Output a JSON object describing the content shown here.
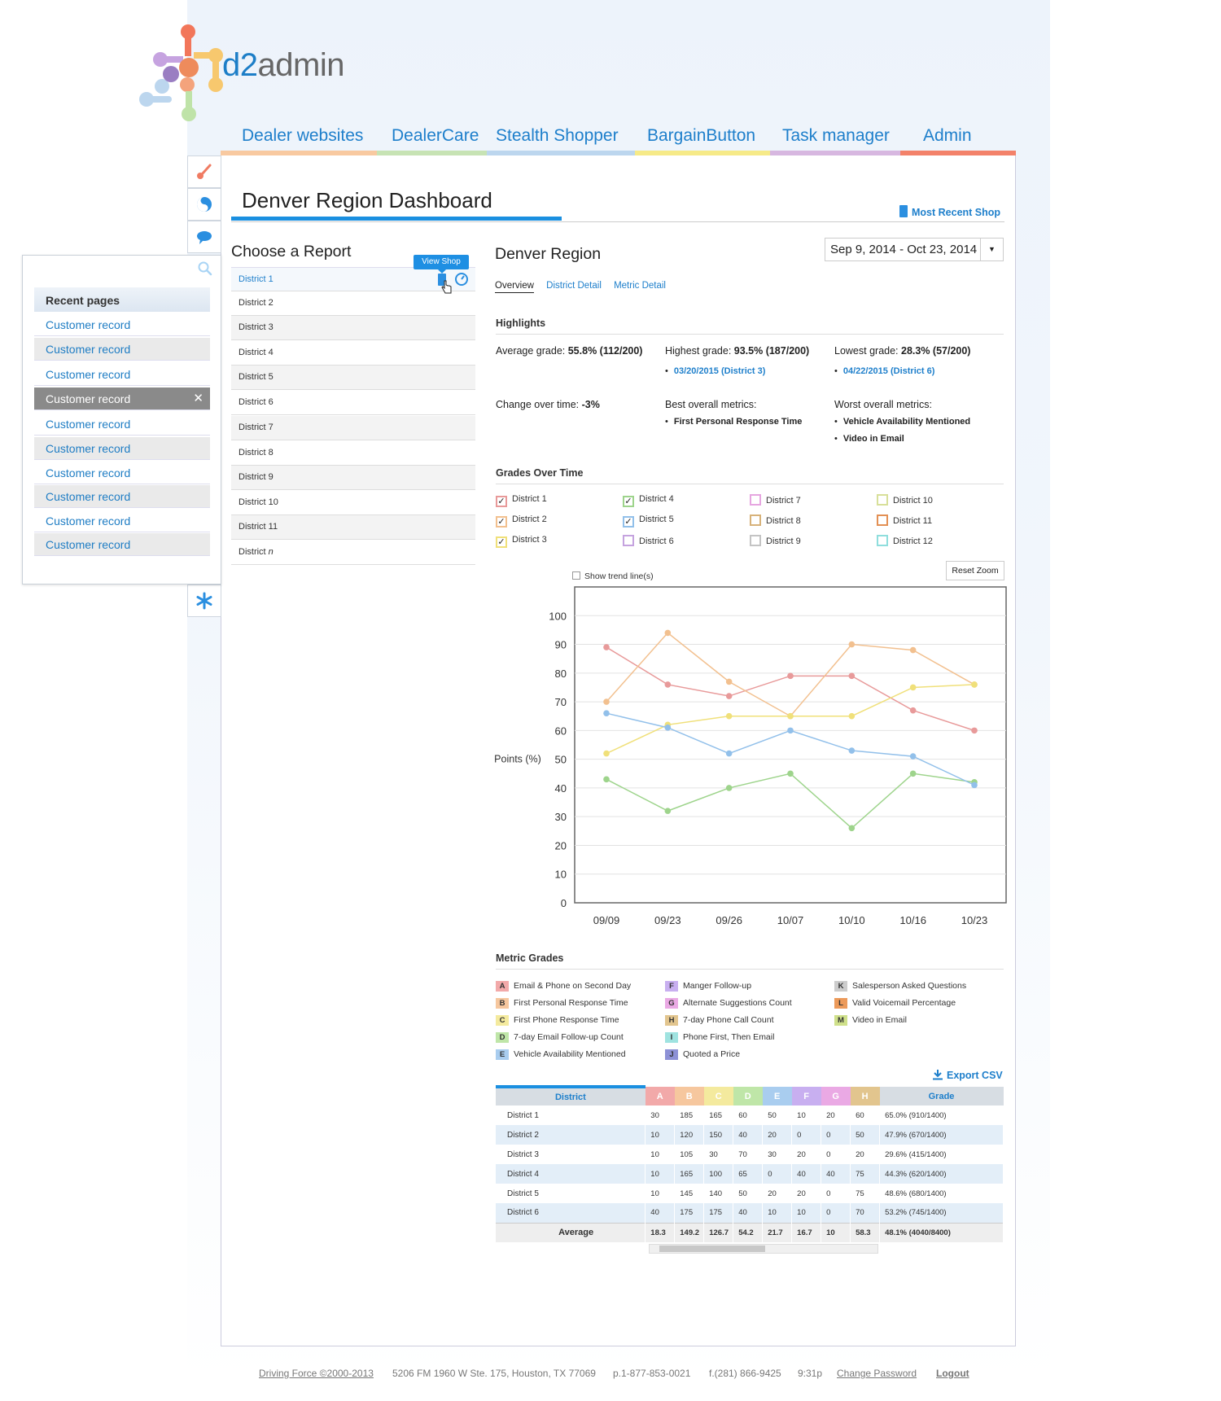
{
  "app": {
    "logo_text": "d2admin",
    "logo_prefix": "d2",
    "logo_suffix": "admin"
  },
  "nav": [
    {
      "label": "Dealer websites",
      "color": "#f8c9a0"
    },
    {
      "label": "DealerCare",
      "color": "#c7e3b4"
    },
    {
      "label": "Stealth Shopper",
      "color": "#bcd6ee"
    },
    {
      "label": "BargainButton",
      "color": "#f6ea88"
    },
    {
      "label": "Task manager",
      "color": "#d7b7e0"
    },
    {
      "label": "Admin",
      "color": "#f3826a"
    }
  ],
  "sidebar_icons": [
    "brush-icon",
    "yin-yang-icon",
    "speech-bubble-icon",
    "search-icon",
    "asterisk-icon"
  ],
  "recent": {
    "heading": "Recent pages",
    "items": [
      "Customer record",
      "Customer record",
      "Customer record",
      "Customer record",
      "Customer record",
      "Customer record",
      "Customer record",
      "Customer record",
      "Customer record",
      "Customer record"
    ]
  },
  "page": {
    "title": "Denver Region Dashboard",
    "most_recent_shop": "Most Recent Shop"
  },
  "report": {
    "heading": "Choose a Report",
    "tooltip": "View Shop",
    "districts": [
      "District 1",
      "District 2",
      "District 3",
      "District 4",
      "District 5",
      "District 6",
      "District 7",
      "District 8",
      "District 9",
      "District 10",
      "District 11",
      "District "
    ],
    "last_italic": "n"
  },
  "region": {
    "title": "Denver Region",
    "date_range": "Sep 9, 2014 - Oct 23, 2014",
    "tabs": [
      "Overview",
      "District Detail",
      "Metric Detail"
    ]
  },
  "highlights": {
    "heading": "Highlights",
    "avg_label": "Average grade: ",
    "avg_value": "55.8% (112/200)",
    "high_label": "Highest grade: ",
    "high_value": "93.5% (187/200)",
    "high_link": "03/20/2015 (District 3)",
    "low_label": "Lowest grade: ",
    "low_value": "28.3% (57/200)",
    "low_link": "04/22/2015 (District 6)",
    "change_label": "Change over time: ",
    "change_value": "-3%",
    "best_label": "Best overall metrics:",
    "best": [
      "First Personal Response Time"
    ],
    "worst_label": "Worst overall metrics:",
    "worst": [
      "Vehicle Availability Mentioned",
      "Video in Email"
    ]
  },
  "grades_over_time": {
    "heading": "Grades Over Time",
    "legend": [
      {
        "label": "District 1",
        "color": "#e89a9a",
        "checked": true
      },
      {
        "label": "District 2",
        "color": "#f2c08f",
        "checked": true
      },
      {
        "label": "District 3",
        "color": "#f0e07a",
        "checked": true
      },
      {
        "label": "District 4",
        "color": "#9ed48c",
        "checked": true
      },
      {
        "label": "District 5",
        "color": "#92c0ea",
        "checked": true
      },
      {
        "label": "District 6",
        "color": "#c5a3df",
        "checked": false
      },
      {
        "label": "District 7",
        "color": "#e6a6e0",
        "checked": false
      },
      {
        "label": "District 8",
        "color": "#d7b27a",
        "checked": false
      },
      {
        "label": "District 9",
        "color": "#c4c4c4",
        "checked": false
      },
      {
        "label": "District 10",
        "color": "#d8e09a",
        "checked": false
      },
      {
        "label": "District 11",
        "color": "#e39054",
        "checked": false
      },
      {
        "label": "District 12",
        "color": "#8fdedd",
        "checked": false
      }
    ],
    "show_trend": "Show trend line(s)",
    "reset_zoom": "Reset Zoom"
  },
  "chart_data": {
    "type": "line",
    "ylabel": "Points (%)",
    "xlabel": "",
    "ylim": [
      0,
      100
    ],
    "yticks": [
      0,
      10,
      20,
      30,
      40,
      50,
      60,
      70,
      80,
      90,
      100
    ],
    "categories": [
      "09/09",
      "09/23",
      "09/26",
      "10/07",
      "10/10",
      "10/16",
      "10/23"
    ],
    "grid": true,
    "series": [
      {
        "name": "District 1",
        "color": "#e89a9a",
        "values": [
          89,
          76,
          72,
          79,
          79,
          67,
          60
        ]
      },
      {
        "name": "District 2",
        "color": "#f2c08f",
        "values": [
          70,
          94,
          77,
          65,
          90,
          88,
          76
        ]
      },
      {
        "name": "District 3",
        "color": "#f0e07a",
        "values": [
          52,
          62,
          65,
          65,
          65,
          75,
          76
        ]
      },
      {
        "name": "District 4",
        "color": "#9ed48c",
        "values": [
          43,
          32,
          40,
          45,
          26,
          45,
          42
        ]
      },
      {
        "name": "District 5",
        "color": "#92c0ea",
        "values": [
          66,
          61,
          52,
          60,
          53,
          51,
          41
        ]
      }
    ]
  },
  "metric_grades": {
    "heading": "Metric Grades",
    "items": [
      {
        "key": "A",
        "label": "Email & Phone on Second Day",
        "color": "#f2a9a9"
      },
      {
        "key": "B",
        "label": "First Personal Response Time",
        "color": "#f6c79e"
      },
      {
        "key": "C",
        "label": "First Phone Response Time",
        "color": "#f4ea9e"
      },
      {
        "key": "D",
        "label": "7-day Email Follow-up Count",
        "color": "#bfe6a8"
      },
      {
        "key": "E",
        "label": "Vehicle Availability Mentioned",
        "color": "#a9cdef"
      },
      {
        "key": "F",
        "label": "Manger Follow-up",
        "color": "#c8aff0"
      },
      {
        "key": "G",
        "label": "Alternate Suggestions Count",
        "color": "#eaa9e4"
      },
      {
        "key": "H",
        "label": "7-day Phone Call Count",
        "color": "#e2c58e"
      },
      {
        "key": "I",
        "label": "Phone First, Then Email",
        "color": "#9fe3e0"
      },
      {
        "key": "J",
        "label": "Quoted a Price",
        "color": "#8d91d6"
      },
      {
        "key": "K",
        "label": "Salesperson Asked Questions",
        "color": "#cccccc"
      },
      {
        "key": "L",
        "label": "Valid Voicemail Percentage",
        "color": "#ec9a5a"
      },
      {
        "key": "M",
        "label": "Video in Email",
        "color": "#cfe08a"
      }
    ],
    "export": "Export CSV"
  },
  "table": {
    "headers": [
      "District",
      "A",
      "B",
      "C",
      "D",
      "E",
      "F",
      "G",
      "H",
      "Grade"
    ],
    "rows": [
      [
        "District 1",
        "30",
        "185",
        "165",
        "60",
        "50",
        "10",
        "20",
        "60",
        "65.0% (910/1400)"
      ],
      [
        "District 2",
        "10",
        "120",
        "150",
        "40",
        "20",
        "0",
        "0",
        "50",
        "47.9% (670/1400)"
      ],
      [
        "District 3",
        "10",
        "105",
        "30",
        "70",
        "30",
        "20",
        "0",
        "20",
        "29.6% (415/1400)"
      ],
      [
        "District 4",
        "10",
        "165",
        "100",
        "65",
        "0",
        "40",
        "40",
        "75",
        "44.3% (620/1400)"
      ],
      [
        "District 5",
        "10",
        "145",
        "140",
        "50",
        "20",
        "20",
        "0",
        "75",
        "48.6% (680/1400)"
      ],
      [
        "District 6",
        "40",
        "175",
        "175",
        "40",
        "10",
        "10",
        "0",
        "70",
        "53.2% (745/1400)"
      ]
    ],
    "average": [
      "Average",
      "18.3",
      "149.2",
      "126.7",
      "54.2",
      "21.7",
      "16.7",
      "10",
      "58.3",
      "48.1% (4040/8400)"
    ]
  },
  "footer": {
    "copyright": "Driving Force ©2000-2013",
    "address": "5206 FM 1960 W Ste. 175, Houston, TX 77069",
    "phone": "p.1-877-853-0021",
    "fax": "f.(281) 866-9425",
    "time": "9:31p",
    "change_password": "Change Password",
    "logout": "Logout"
  }
}
